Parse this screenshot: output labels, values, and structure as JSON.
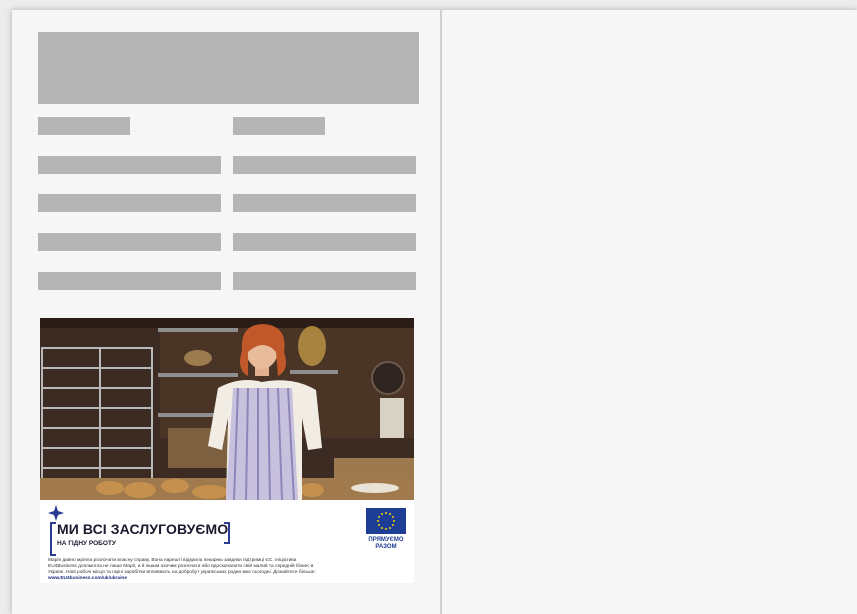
{
  "ad": {
    "headline": "МИ ВСІ ЗАСЛУГОВУЄМО",
    "subheadline": "НА ГІДНУ РОБОТУ",
    "body_text": "Марія давно мріяла розпочати власну справу. Вона нарешті відкрила пекарню завдяки підтримці ЄС. Ініціатива EU4Business допомогла не лише Марії, а й іншим охочим розпочати або вдосконалити свій малий та середній бізнес в Україні. Нові робочі місця та гарні заробітки впливають на добробут українських родин вже сьогодні. Дізнайтеся більше:",
    "link": "www.EU4business.com/uk/ukraine",
    "eu_label_line1": "ПРЯМУЄМО",
    "eu_label_line2": "РАЗОМ"
  },
  "colors": {
    "placeholder": "#b5b5b5",
    "brand_blue": "#1e3d94",
    "eu_star": "#f5d400"
  }
}
